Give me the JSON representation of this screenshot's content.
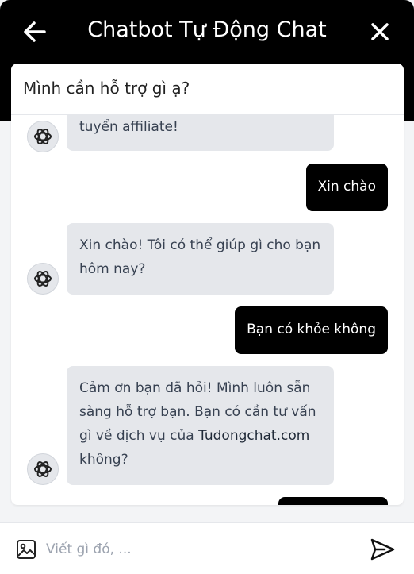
{
  "header": {
    "title": "Chatbot Tự Động Chat",
    "background": "#000000"
  },
  "chat": {
    "prompt": "Mình cần hỗ trợ gì ạ?",
    "messages": [
      {
        "role": "bot",
        "text": "tuyển affiliate!"
      },
      {
        "role": "user",
        "text": "Xin chào"
      },
      {
        "role": "bot",
        "text": "Xin chào! Tôi có thể giúp gì cho bạn hôm nay?"
      },
      {
        "role": "user",
        "text": "Bạn có khỏe không"
      },
      {
        "role": "bot",
        "text_before": "Cảm ơn bạn đã hỏi! Mình luôn sẵn sàng hỗ trợ bạn. Bạn có cần tư vấn gì về dịch vụ của ",
        "link": "Tudongchat.com",
        "text_after": " không?"
      }
    ]
  },
  "input": {
    "placeholder": "Viết gì đó, ..."
  },
  "icons": {
    "back": "arrow-left-icon",
    "close": "close-icon",
    "bot_avatar": "openai-logo-icon",
    "attach": "image-icon",
    "send": "send-icon"
  }
}
